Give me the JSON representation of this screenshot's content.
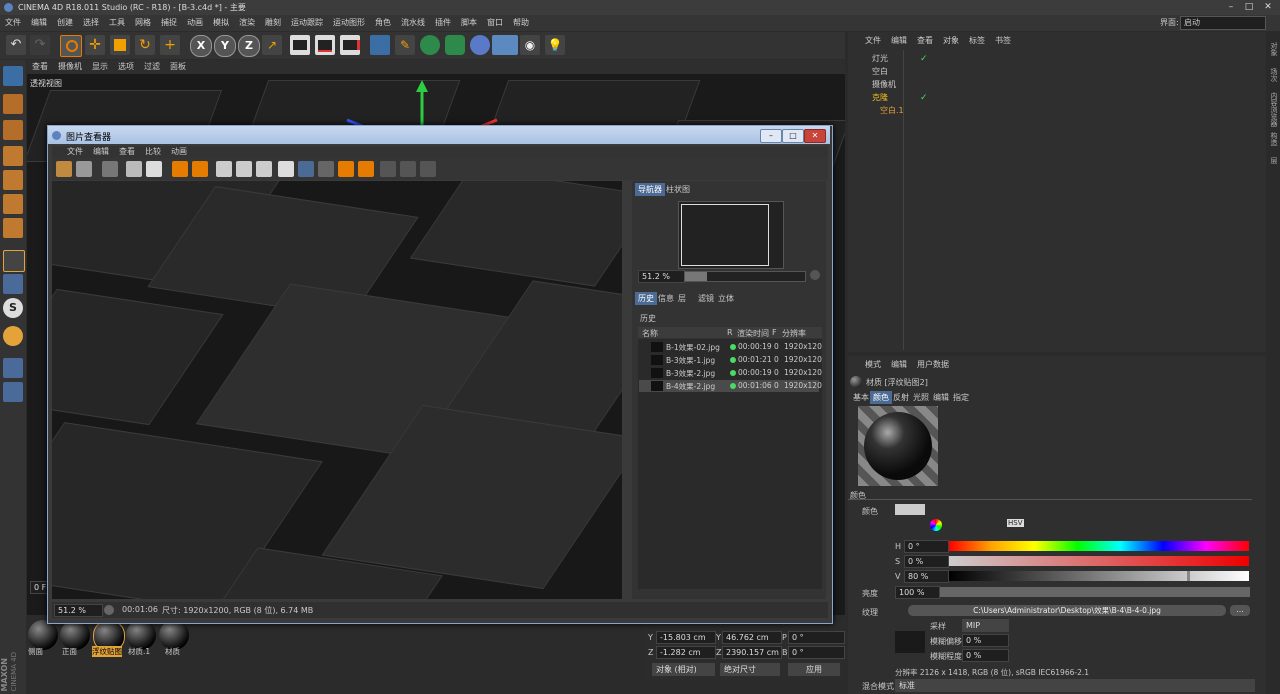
{
  "window": {
    "title": "CINEMA 4D R18.011 Studio (RC - R18) - [B-3.c4d *] - 主要",
    "layout_label": "界面:",
    "layout_value": "启动"
  },
  "menubar": [
    "文件",
    "编辑",
    "创建",
    "选择",
    "工具",
    "网格",
    "捕捉",
    "动画",
    "模拟",
    "渲染",
    "雕刻",
    "运动跟踪",
    "运动图形",
    "角色",
    "流水线",
    "插件",
    "脚本",
    "窗口",
    "帮助"
  ],
  "toolbar": {
    "axes": [
      "X",
      "Y",
      "Z"
    ]
  },
  "viewport": {
    "menu": [
      "查看",
      "摄像机",
      "显示",
      "选项",
      "过滤",
      "面板"
    ],
    "label": "透视视图"
  },
  "object_manager": {
    "menu": [
      "文件",
      "编辑",
      "查看",
      "对象",
      "标签",
      "书签"
    ],
    "objects": [
      "灯光",
      "空白",
      "摄像机",
      "克隆",
      "空白.1"
    ]
  },
  "right_tabs": [
    "对象",
    "场次",
    "内容浏览器",
    "构造",
    "层"
  ],
  "picture_viewer": {
    "title": "图片查看器",
    "menu": [
      "文件",
      "编辑",
      "查看",
      "比较",
      "动画"
    ],
    "nav_tabs": [
      "导航器",
      "柱状图"
    ],
    "zoom": "51.2 %",
    "tabs": [
      "历史",
      "信息",
      "层",
      "滤镜",
      "立体"
    ],
    "section_title": "历史",
    "columns": [
      "名称",
      "R",
      "渲染时间",
      "F",
      "分辨率"
    ],
    "history": [
      {
        "name": "B-1效果-02.jpg",
        "time": "00:00:19",
        "f": "0",
        "res": "1920x120"
      },
      {
        "name": "B-3效果-1.jpg",
        "time": "00:01:21",
        "f": "0",
        "res": "1920x120"
      },
      {
        "name": "B-3效果-2.jpg",
        "time": "00:00:19",
        "f": "0",
        "res": "1920x120"
      },
      {
        "name": "B-4效果-2.jpg",
        "time": "00:01:06",
        "f": "0",
        "res": "1920x120"
      }
    ],
    "status_zoom": "51.2 %",
    "status_time": "00:01:06",
    "status_info": "尺寸: 1920x1200, RGB (8 位), 6.74 MB"
  },
  "coords": {
    "y_label": "Y",
    "y_value": "-15.803 cm",
    "y2_label": "Y",
    "y2_value": "46.762 cm",
    "p_label": "P",
    "p_value": "0 °",
    "z_label": "Z",
    "z_value": "-1.282 cm",
    "z2_label": "Z",
    "z2_value": "2390.157 cm",
    "b_label": "B",
    "b_value": "0 °",
    "mode": "对象 (相对)",
    "size_mode": "绝对尺寸",
    "apply": "应用"
  },
  "materials": [
    "侧面",
    "正面",
    "浮纹贴图",
    "材质.1",
    "材质"
  ],
  "frame_field": "0 F",
  "attributes": {
    "menu": [
      "模式",
      "编辑",
      "用户数据"
    ],
    "material_title": "材质 [浮纹贴图2]",
    "tabs": [
      "基本",
      "颜色",
      "反射",
      "光照",
      "编辑",
      "指定"
    ],
    "active_tab": "颜色",
    "section": "颜色",
    "color_label": "颜色",
    "h_label": "H",
    "h_value": "0 °",
    "s_label": "S",
    "s_value": "0 %",
    "v_label": "V",
    "v_value": "80 %",
    "brightness_label": "亮度",
    "brightness_value": "100 %",
    "texture_label": "纹理",
    "texture_path": "C:\\Users\\Administrator\\Desktop\\效果\\B-4\\B-4-0.jpg",
    "sampling_label": "采样",
    "sampling_value": "MIP",
    "blur_offset_label": "模糊偏移",
    "blur_offset_value": "0 %",
    "blur_scale_label": "模糊程度",
    "blur_scale_value": "0 %",
    "resolution_info": "分辨率 2126 x 1418, RGB (8 位), sRGB IEC61966-2.1",
    "blend_label": "混合模式",
    "blend_value": "标准",
    "hsv_badge": "HSV"
  },
  "maxon": {
    "line1": "MAXON",
    "line2": "CINEMA 4D"
  },
  "colors": {
    "bg": "#2b2b2b",
    "accent": "#4c6b94",
    "highlight": "#e3a23a"
  }
}
